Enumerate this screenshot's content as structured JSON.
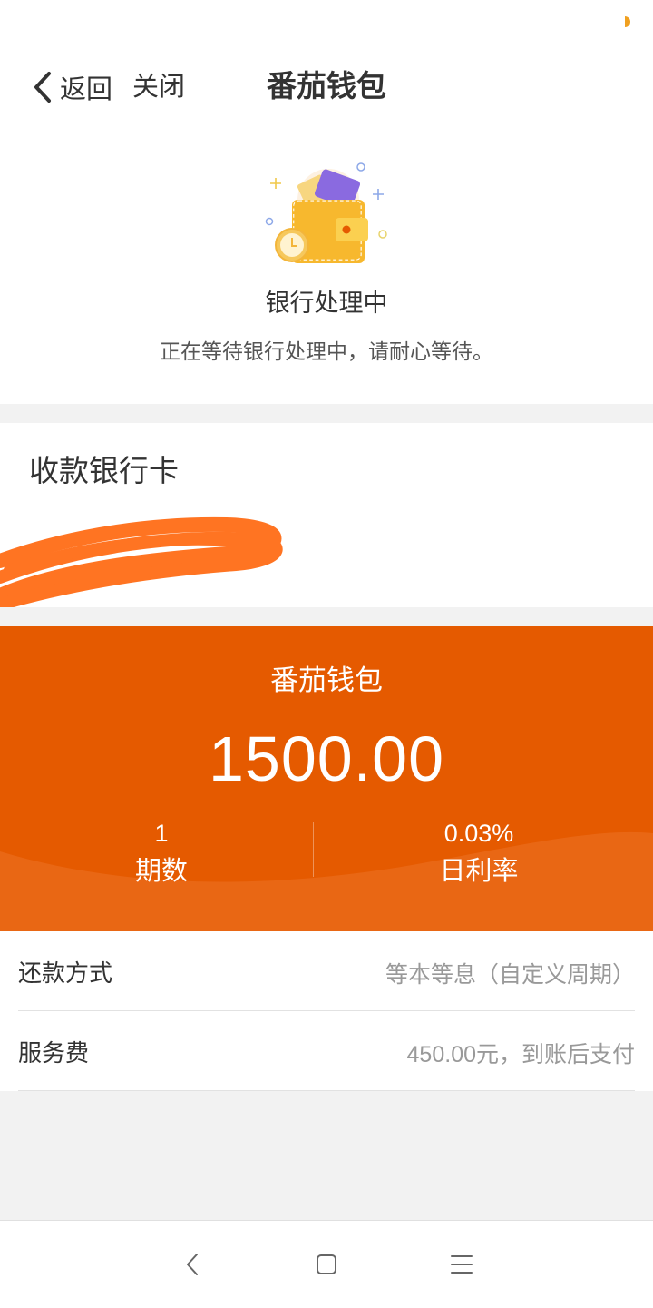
{
  "nav": {
    "back_label": "返回",
    "close_label": "关闭",
    "title": "番茄钱包"
  },
  "status": {
    "title": "银行处理中",
    "description": "正在等待银行处理中，请耐心等待。",
    "icon": "wallet-icon"
  },
  "bank": {
    "heading": "收款银行卡"
  },
  "loan": {
    "name": "番茄钱包",
    "amount": "1500.00",
    "periods_value": "1",
    "periods_label": "期数",
    "rate_value": "0.03%",
    "rate_label": "日利率"
  },
  "details": {
    "rows": [
      {
        "label": "还款方式",
        "value": "等本等息（自定义周期）"
      },
      {
        "label": "服务费",
        "value": "450.00元，到账后支付"
      }
    ]
  },
  "colors": {
    "accent": "#e55a00",
    "redaction": "#ff7422"
  },
  "system_nav": {
    "icons": [
      "back-icon",
      "home-icon",
      "menu-icon"
    ]
  }
}
